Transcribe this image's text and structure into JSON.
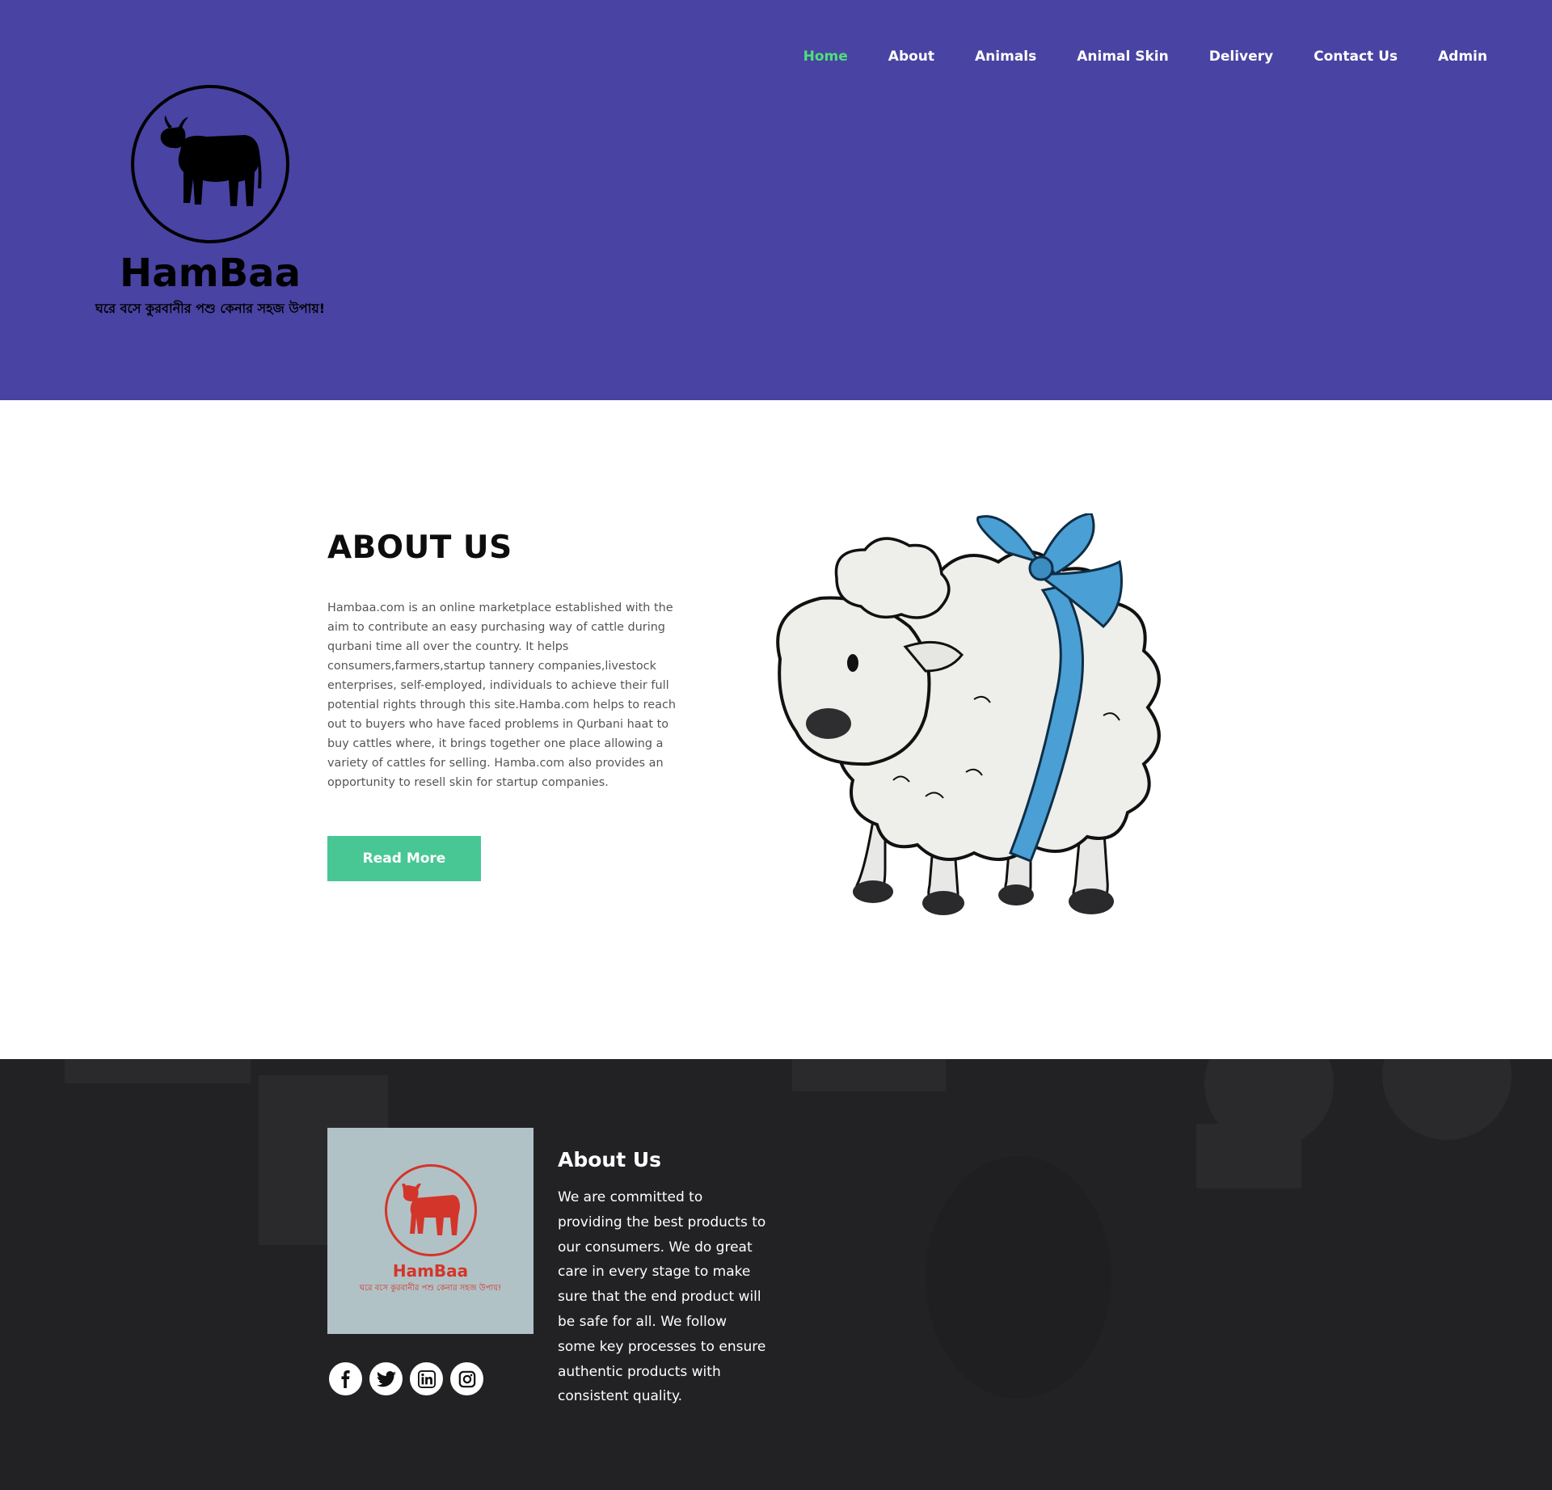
{
  "colors": {
    "header_bg": "#4943a3",
    "nav_active": "#4ce07a",
    "button_bg": "#48c795",
    "footer_bg": "#222224",
    "footer_logo_bg": "#b1c2c6",
    "footer_logo_accent": "#d4352a"
  },
  "nav": {
    "items": [
      {
        "label": "Home",
        "active": true
      },
      {
        "label": "About"
      },
      {
        "label": "Animals"
      },
      {
        "label": "Animal Skin"
      },
      {
        "label": "Delivery"
      },
      {
        "label": "Contact Us"
      },
      {
        "label": "Admin"
      }
    ]
  },
  "logo": {
    "icon": "cow-icon",
    "title": "HamBaa",
    "tagline": "ঘরে বসে কুরবানীর পশু কেনার সহজ উপায়!"
  },
  "about": {
    "heading": "ABOUT US",
    "text": "Hambaa.com is an online marketplace established with the aim to contribute an easy purchasing way of cattle during qurbani time all over the country. It helps consumers,farmers,startup tannery companies,livestock enterprises, self-employed, individuals to achieve their full potential rights through this site.Hamba.com helps to reach out to buyers who have faced problems in Qurbani haat to buy cattles where, it brings together one place allowing a variety of cattles for selling. Hamba.com also provides an opportunity to resell skin for startup companies.",
    "button_label": "Read More",
    "image": "sheep-illustration"
  },
  "footer": {
    "logo_title": "HamBaa",
    "logo_tagline": "ঘরে বসে কুরবানীর পশু কেনার সহজ উপায়!",
    "heading": "About Us",
    "text": "We are committed to providing the best products to our consumers. We do great care in every stage to make sure that the end product will be safe for all. We follow some key processes to ensure authentic products with consistent quality.",
    "socials": [
      "facebook-icon",
      "twitter-icon",
      "linkedin-icon",
      "instagram-icon"
    ]
  }
}
